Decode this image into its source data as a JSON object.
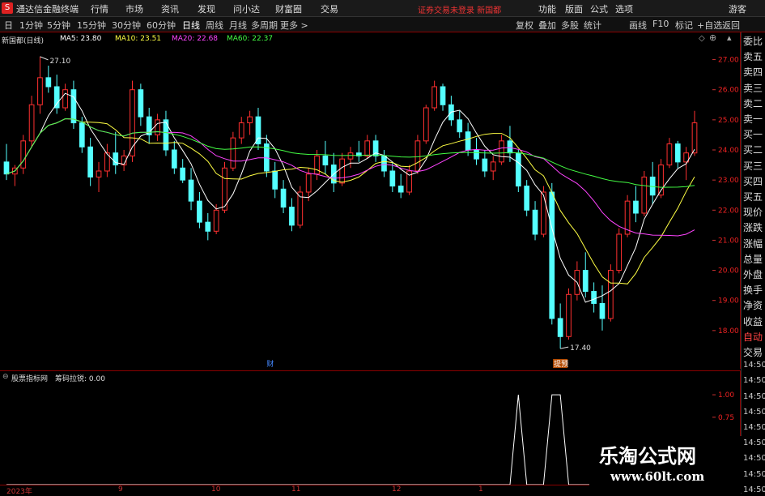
{
  "app": {
    "logo": "S",
    "title": "通达信金融终端"
  },
  "menu": [
    "行情",
    "市场",
    "资讯",
    "发现",
    "问小达",
    "财富圈",
    "交易"
  ],
  "notice": "证券交易未登录  新国都",
  "right_menu": [
    "功能",
    "版面",
    "公式",
    "选项",
    "游客"
  ],
  "periods": [
    "日",
    "1分钟",
    "5分钟",
    "15分钟",
    "30分钟",
    "60分钟",
    "日线",
    "周线",
    "月线",
    "多周期",
    "更多 >"
  ],
  "toolbar_right": [
    "复权",
    "叠加",
    "多股",
    "统计",
    "画线",
    "F10",
    "标记",
    "+自选",
    "返回"
  ],
  "stock_label": "新国都(日线)",
  "ma": [
    {
      "label": "MA5: 23.80",
      "color": "#ffffff"
    },
    {
      "label": "MA10: 23.51",
      "color": "#ffff44"
    },
    {
      "label": "MA20: 22.68",
      "color": "#ff44ff"
    },
    {
      "label": "MA60: 22.37",
      "color": "#44ff44"
    }
  ],
  "annotations": {
    "high": "27.10",
    "low": "17.40",
    "cai": "财",
    "ti": "提预"
  },
  "indicator": {
    "name": "股票指标网",
    "formula": "筹码拉锐: 0.00"
  },
  "x_labels": [
    "2023年",
    "9",
    "10",
    "11",
    "12",
    "1"
  ],
  "side_panel": [
    "委比",
    "卖五",
    "卖四",
    "卖三",
    "卖二",
    "卖一",
    "买一",
    "买二",
    "买三",
    "买四",
    "买五",
    "现价",
    "涨跌",
    "涨幅",
    "总量",
    "外盘",
    "换手",
    "净资",
    "收益",
    "自动",
    "交易",
    "14:50",
    "14:50",
    "14:50",
    "14:50",
    "14:50",
    "14:50",
    "14:50",
    "14:50",
    "14:50"
  ],
  "watermark": {
    "title": "乐淘公式网",
    "url": "www.60lt.com"
  },
  "chart_data": [
    {
      "type": "candlestick",
      "title": "新国都(日线)",
      "ylim": [
        17,
        27.5
      ],
      "y_ticks": [
        27.0,
        26.0,
        25.0,
        24.0,
        23.0,
        22.0,
        21.0,
        20.0,
        19.0,
        18.0
      ],
      "x_labels": [
        "2023年",
        "9",
        "10",
        "11",
        "12",
        "1"
      ],
      "ohlc": [
        [
          23.6,
          24.2,
          23.0,
          23.2
        ],
        [
          23.2,
          23.5,
          22.8,
          23.4
        ],
        [
          23.4,
          24.5,
          23.2,
          24.3
        ],
        [
          24.3,
          25.8,
          24.1,
          25.5
        ],
        [
          25.5,
          27.1,
          25.2,
          26.4
        ],
        [
          26.4,
          26.8,
          25.9,
          26.1
        ],
        [
          26.1,
          26.5,
          25.2,
          25.4
        ],
        [
          25.4,
          26.2,
          25.3,
          26.0
        ],
        [
          26.0,
          26.3,
          24.7,
          24.9
        ],
        [
          24.9,
          25.1,
          23.9,
          24.1
        ],
        [
          24.1,
          24.4,
          22.8,
          23.1
        ],
        [
          23.1,
          23.6,
          22.6,
          23.3
        ],
        [
          23.3,
          24.2,
          23.1,
          23.9
        ],
        [
          23.9,
          24.6,
          23.2,
          23.5
        ],
        [
          23.5,
          24.0,
          23.3,
          23.8
        ],
        [
          23.8,
          26.3,
          23.6,
          26.0
        ],
        [
          26.0,
          26.2,
          24.8,
          25.1
        ],
        [
          25.1,
          25.4,
          24.2,
          24.5
        ],
        [
          24.5,
          25.2,
          24.3,
          25.0
        ],
        [
          25.0,
          25.3,
          23.8,
          24.0
        ],
        [
          24.0,
          24.3,
          23.2,
          23.4
        ],
        [
          23.4,
          23.7,
          22.9,
          23.0
        ],
        [
          23.0,
          23.4,
          22.0,
          22.3
        ],
        [
          22.3,
          22.6,
          21.4,
          21.6
        ],
        [
          21.6,
          21.9,
          21.0,
          21.3
        ],
        [
          21.3,
          22.2,
          21.2,
          22.0
        ],
        [
          22.0,
          23.6,
          21.9,
          23.4
        ],
        [
          23.4,
          24.6,
          23.3,
          24.4
        ],
        [
          24.4,
          25.1,
          24.2,
          24.9
        ],
        [
          24.9,
          25.3,
          24.5,
          25.1
        ],
        [
          25.1,
          25.4,
          24.0,
          24.2
        ],
        [
          24.2,
          24.5,
          23.1,
          23.3
        ],
        [
          23.3,
          23.6,
          22.4,
          22.7
        ],
        [
          22.7,
          23.0,
          21.9,
          22.1
        ],
        [
          22.1,
          22.4,
          21.3,
          21.5
        ],
        [
          21.5,
          22.8,
          21.4,
          22.6
        ],
        [
          22.6,
          23.4,
          22.3,
          23.2
        ],
        [
          23.2,
          24.0,
          23.0,
          23.8
        ],
        [
          23.8,
          24.3,
          23.2,
          23.5
        ],
        [
          23.5,
          23.9,
          22.6,
          22.9
        ],
        [
          22.9,
          23.9,
          22.8,
          23.7
        ],
        [
          23.7,
          24.1,
          23.4,
          23.9
        ],
        [
          23.9,
          24.3,
          23.6,
          23.8
        ],
        [
          23.8,
          24.5,
          23.7,
          24.3
        ],
        [
          24.3,
          24.5,
          23.6,
          23.8
        ],
        [
          23.8,
          24.0,
          23.1,
          23.3
        ],
        [
          23.3,
          23.6,
          22.6,
          22.8
        ],
        [
          22.8,
          23.2,
          22.4,
          22.6
        ],
        [
          22.6,
          23.5,
          22.5,
          23.3
        ],
        [
          23.3,
          24.5,
          23.2,
          24.3
        ],
        [
          24.3,
          25.5,
          24.2,
          25.4
        ],
        [
          25.4,
          26.3,
          25.3,
          26.1
        ],
        [
          26.1,
          26.2,
          25.3,
          25.5
        ],
        [
          25.5,
          25.8,
          24.8,
          25.0
        ],
        [
          25.0,
          25.3,
          24.4,
          24.6
        ],
        [
          24.6,
          24.9,
          23.8,
          24.0
        ],
        [
          24.0,
          24.4,
          23.5,
          23.7
        ],
        [
          23.7,
          24.0,
          23.1,
          23.3
        ],
        [
          23.3,
          23.8,
          23.0,
          23.6
        ],
        [
          23.6,
          24.5,
          23.5,
          24.3
        ],
        [
          24.3,
          24.8,
          23.6,
          23.9
        ],
        [
          23.9,
          24.0,
          22.6,
          22.8
        ],
        [
          22.8,
          23.0,
          21.8,
          22.0
        ],
        [
          22.0,
          22.3,
          21.0,
          21.2
        ],
        [
          21.2,
          22.8,
          21.1,
          22.6
        ],
        [
          22.6,
          22.9,
          18.2,
          18.4
        ],
        [
          18.4,
          18.9,
          17.4,
          17.8
        ],
        [
          17.8,
          19.4,
          17.7,
          19.2
        ],
        [
          19.2,
          20.3,
          19.0,
          20.0
        ],
        [
          20.0,
          20.6,
          19.1,
          19.3
        ],
        [
          19.3,
          19.6,
          18.6,
          18.9
        ],
        [
          18.9,
          19.5,
          18.0,
          18.4
        ],
        [
          18.4,
          20.2,
          18.3,
          20.0
        ],
        [
          20.0,
          21.4,
          19.9,
          21.2
        ],
        [
          21.2,
          22.5,
          21.1,
          22.3
        ],
        [
          22.3,
          22.8,
          21.6,
          21.9
        ],
        [
          21.9,
          23.3,
          21.8,
          23.1
        ],
        [
          23.1,
          23.6,
          22.2,
          22.5
        ],
        [
          22.5,
          23.7,
          22.4,
          23.5
        ],
        [
          23.5,
          24.4,
          23.4,
          24.2
        ],
        [
          24.2,
          24.3,
          23.4,
          23.6
        ],
        [
          23.6,
          24.1,
          23.0,
          23.9
        ],
        [
          23.9,
          25.3,
          23.8,
          24.9
        ]
      ],
      "ma": [
        {
          "name": "MA5",
          "value": 23.8
        },
        {
          "name": "MA10",
          "value": 23.51
        },
        {
          "name": "MA20",
          "value": 22.68
        },
        {
          "name": "MA60",
          "value": 22.37
        }
      ],
      "annotations": {
        "high": 27.1,
        "low": 17.4
      }
    },
    {
      "type": "line",
      "title": "筹码拉锐",
      "ylim": [
        0,
        1.1
      ],
      "y_ticks": [
        1.0,
        0.75,
        0.5,
        0.25
      ],
      "spikes": [
        {
          "start_bar": 61,
          "end_bar": 61,
          "value": 1
        },
        {
          "start_bar": 65,
          "end_bar": 66,
          "value": 1
        }
      ],
      "current": 0.0
    }
  ]
}
